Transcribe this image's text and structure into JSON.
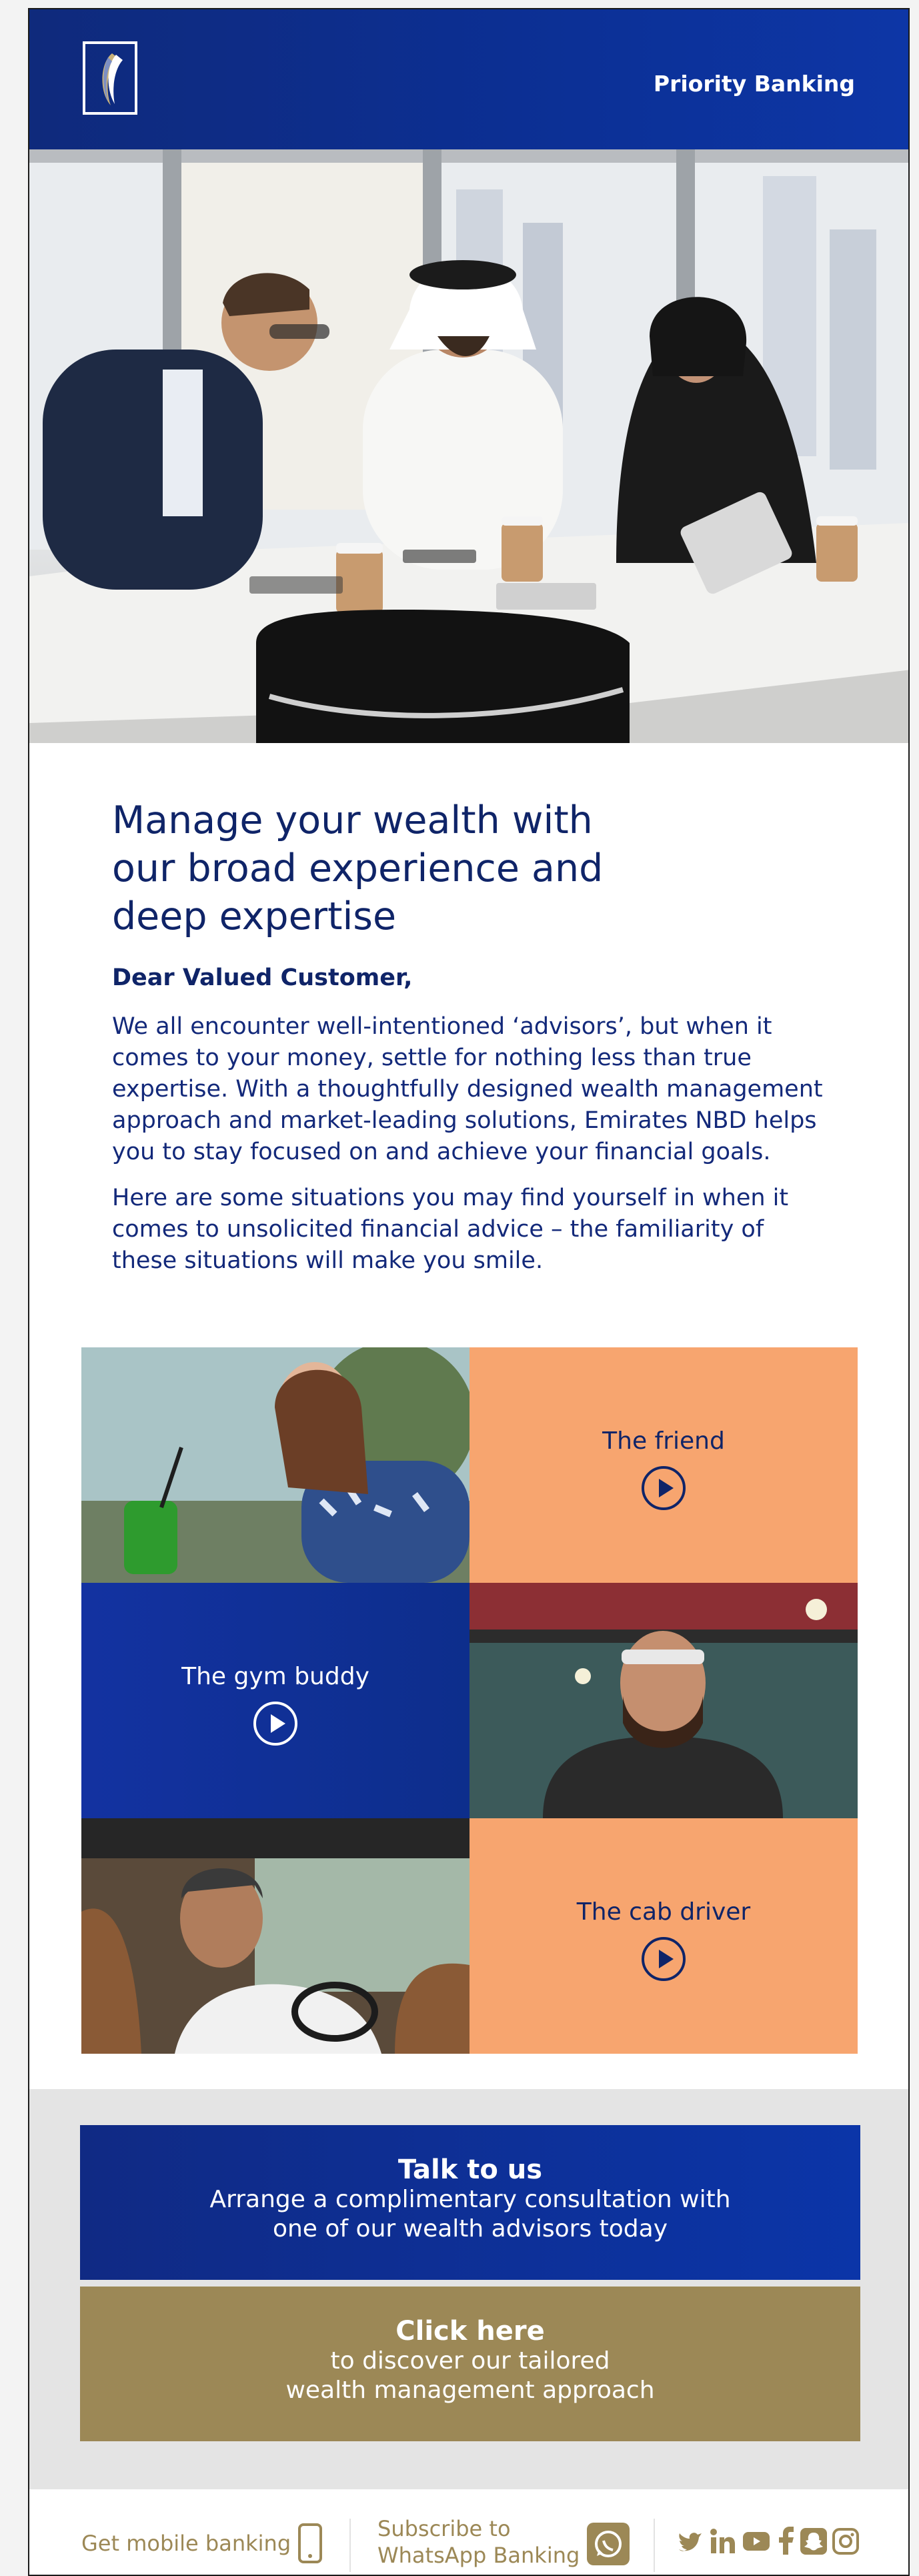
{
  "header": {
    "brand_label": "Priority Banking",
    "logo_icon": "emirates-nbd-logo"
  },
  "hero": {
    "image": "photo of three colleagues in a meeting at a table"
  },
  "intro": {
    "heading": "Manage your wealth with our broad experience and deep expertise",
    "salutation": "Dear Valued Customer,",
    "paragraph1": "We all encounter well-intentioned ‘advisors’, but when it comes to your money, settle for nothing less than true expertise. With a thoughtfully designed wealth management approach and market-leading solutions, Emirates NBD helps you to stay focused on and achieve your financial goals.",
    "paragraph2": "Here are some situations you may find yourself in when it comes to unsolicited financial advice – the familiarity of these situations will make you smile."
  },
  "videos": [
    {
      "label": "The friend",
      "icon": "play-icon"
    },
    {
      "label": "The gym buddy",
      "icon": "play-icon"
    },
    {
      "label": "The cab driver",
      "icon": "play-icon"
    }
  ],
  "cta": {
    "talk": {
      "title": "Talk to us",
      "line1": "Arrange a complimentary consultation with",
      "line2": "one of our wealth advisors today"
    },
    "click": {
      "title": "Click here",
      "line1": "to discover our tailored",
      "line2": "wealth management approach"
    }
  },
  "footer": {
    "mobile_label": "Get mobile banking",
    "whatsapp_line1": "Subscribe to",
    "whatsapp_line2": "WhatsApp Banking",
    "social_icons": [
      "twitter-icon",
      "linkedin-icon",
      "youtube-icon",
      "facebook-icon",
      "snapchat-icon",
      "instagram-icon"
    ]
  },
  "colors": {
    "navy": "#0f2468",
    "brand_blue": "#0c2f93",
    "orange": "#f7a56f",
    "gold": "#9c8856"
  }
}
